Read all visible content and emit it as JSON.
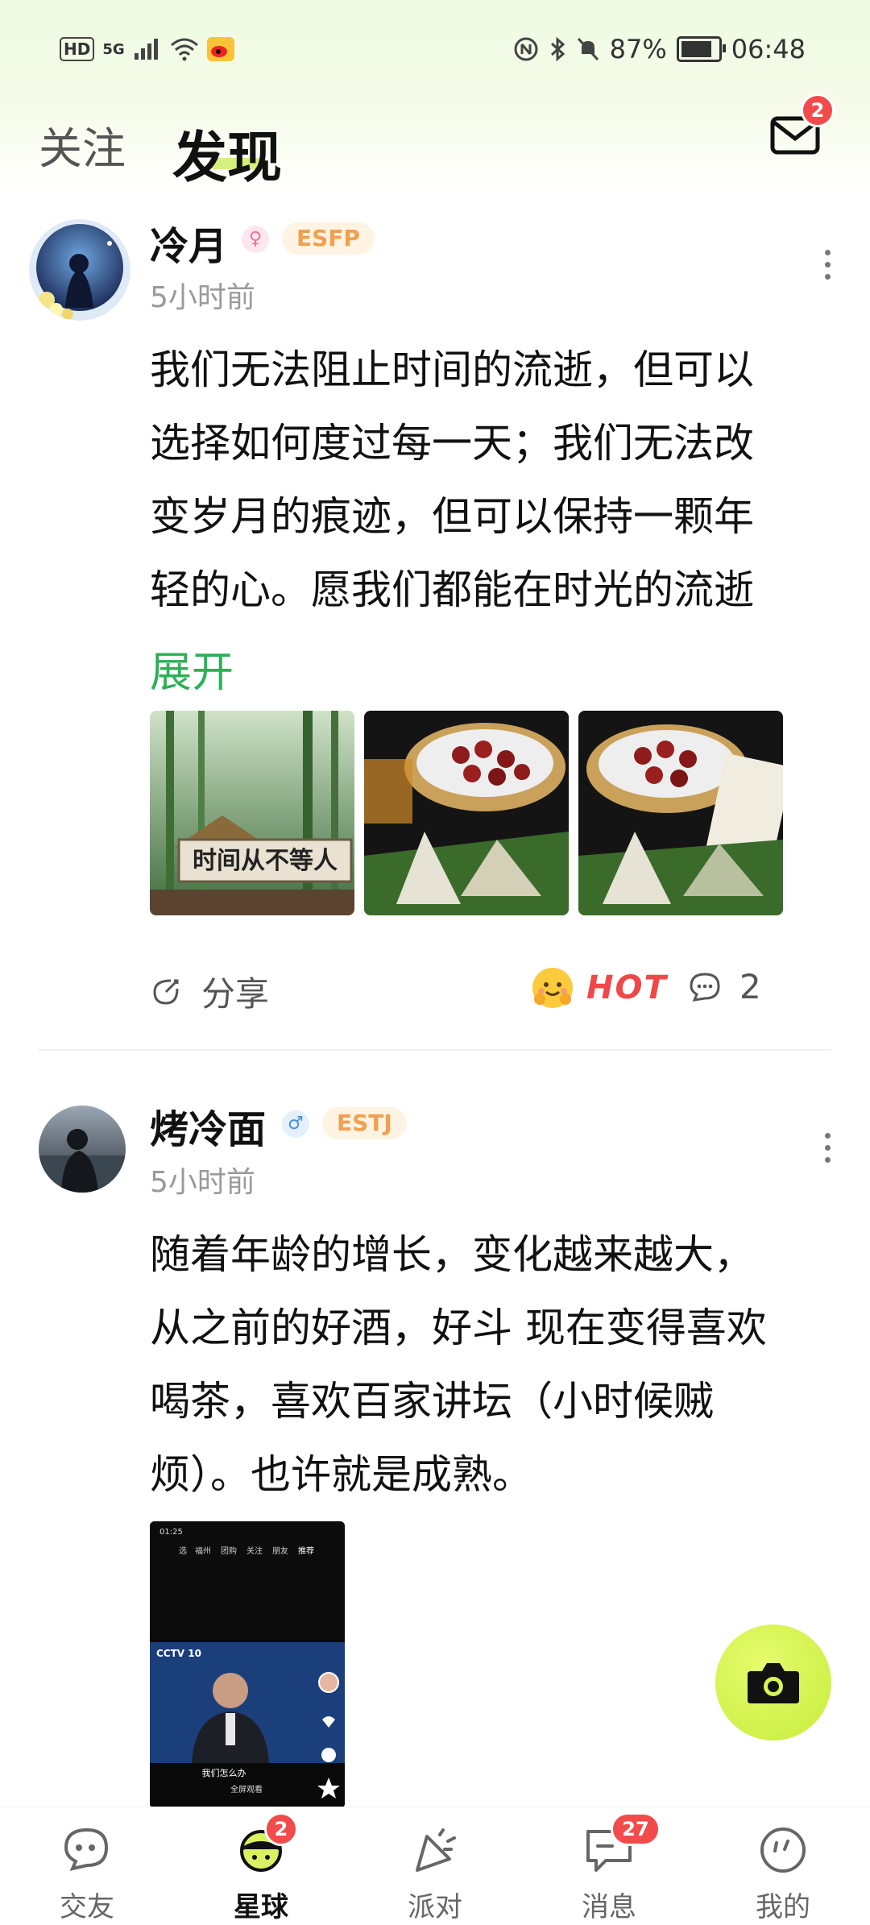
{
  "status_bar": {
    "network_hd": "HD",
    "network_gen": "5G",
    "battery": "87%",
    "battery_level": 0.87,
    "time": "06:48"
  },
  "header": {
    "tab_follow": "关注",
    "tab_discover": "发现",
    "mail_badge": "2"
  },
  "posts": [
    {
      "username": "冷月",
      "gender": "female",
      "mbti": "ESFP",
      "time": "5小时前",
      "text_lines": [
        "我们无法阻止时间的流逝，但可以",
        "选择如何度过每一天；我们无法改",
        "变岁月的痕迹，但可以保持一颗年",
        "轻的心。愿我们都能在时光的流逝"
      ],
      "expand_label": "展开",
      "photo_captions": [
        "时间从不等人"
      ],
      "share_label": "分享",
      "hot_label": "HOT",
      "comment_count": "2"
    },
    {
      "username": "烤冷面",
      "gender": "male",
      "mbti": "ESTJ",
      "time": "5小时前",
      "text_lines": [
        "随着年龄的增长，变化越来越大，",
        "从之前的好酒，好斗 现在变得喜欢",
        "喝茶，喜欢百家讲坛（小时候贼",
        "烦）。也许就是成熟。"
      ],
      "video": {
        "time": "01:25",
        "tabs": [
          "选",
          "福州",
          "团购",
          "关注",
          "朋友",
          "推荐"
        ],
        "channel": "CCTV 10",
        "caption": "我们怎么办",
        "button": "全屏观看"
      }
    }
  ],
  "nav": [
    {
      "label": "交友",
      "icon": "chat-bubbles-icon"
    },
    {
      "label": "星球",
      "icon": "planet-icon",
      "badge": "2"
    },
    {
      "label": "派对",
      "icon": "party-popper-icon"
    },
    {
      "label": "消息",
      "icon": "message-icon",
      "badge": "27"
    },
    {
      "label": "我的",
      "icon": "profile-icon"
    }
  ],
  "colors": {
    "accent_green": "#2bb056",
    "lime": "#d5f07c",
    "badge_red": "#f24b4b",
    "mbti_orange": "#f0a050"
  }
}
